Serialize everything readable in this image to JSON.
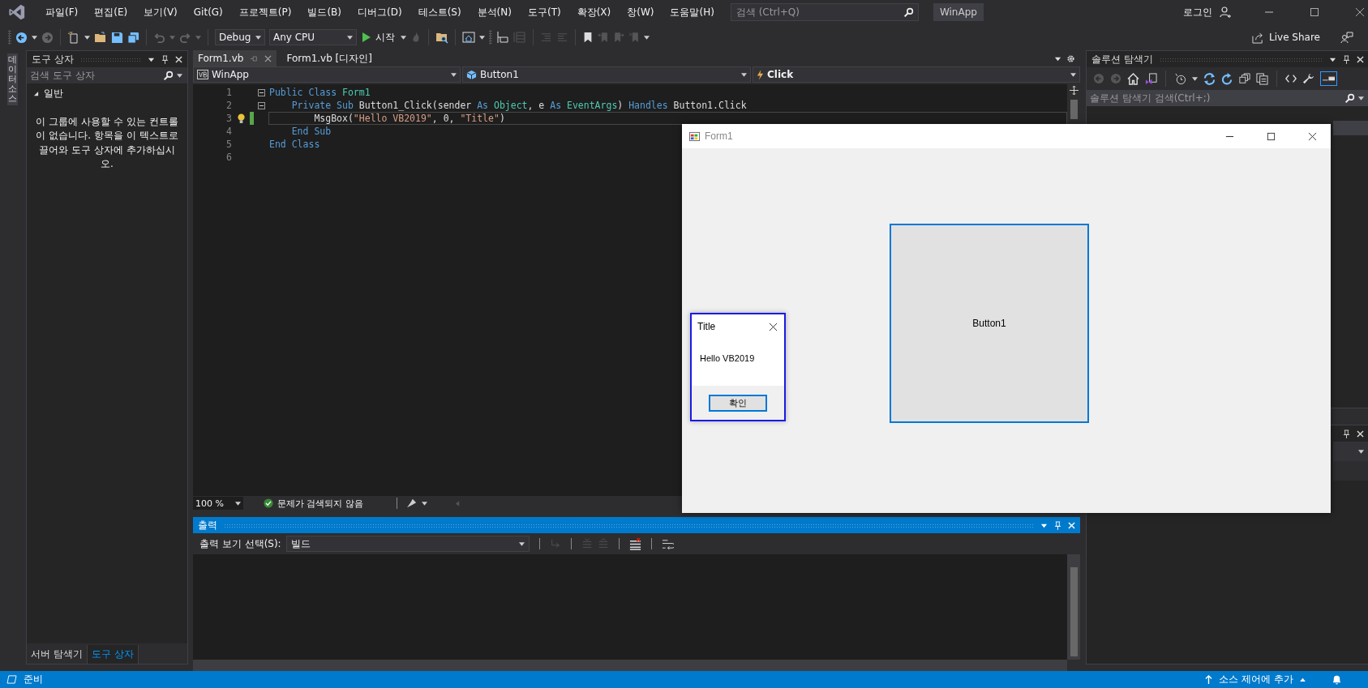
{
  "menu_bar": {
    "items": [
      "파일(F)",
      "편집(E)",
      "보기(V)",
      "Git(G)",
      "프로젝트(P)",
      "빌드(B)",
      "디버그(D)",
      "테스트(S)",
      "분석(N)",
      "도구(T)",
      "확장(X)",
      "창(W)",
      "도움말(H)"
    ],
    "search": {
      "placeholder": "검색 (Ctrl+Q)"
    },
    "solution_name": "WinApp",
    "login": "로그인"
  },
  "toolbar": {
    "configuration": "Debug",
    "platform": "Any CPU",
    "start": "시작",
    "live_share": "Live Share"
  },
  "side_tab": {
    "label": "데이터 소스"
  },
  "toolbox": {
    "title": "도구 상자",
    "search": {
      "placeholder": "검색 도구 상자"
    },
    "group": {
      "label": "일반",
      "expanded": true
    },
    "empty_message": "이 그룹에 사용할 수 있는 컨트롤이 없습니다. 항목을 이 텍스트로 끌어와 도구 상자에 추가하십시오.",
    "tabs": [
      {
        "label": "서버 탐색기",
        "selected": false
      },
      {
        "label": "도구 상자",
        "selected": true
      }
    ]
  },
  "editor": {
    "tabs": [
      {
        "label": "Form1.vb",
        "selected": true
      },
      {
        "label": "Form1.vb [디자인]",
        "selected": false
      }
    ],
    "nav": {
      "project": "WinApp",
      "object": "Button1",
      "member": "Click"
    },
    "lines": [
      {
        "number": "1",
        "fold": true,
        "current": false,
        "modified": false,
        "lightbulb": false,
        "segments": [
          {
            "text": "Public Class",
            "kind": "keyword"
          },
          {
            "text": " Form1",
            "kind": "type"
          }
        ]
      },
      {
        "number": "2",
        "fold": true,
        "current": false,
        "modified": false,
        "lightbulb": false,
        "segments": [
          {
            "text": "    Private Sub",
            "kind": "keyword"
          },
          {
            "text": " Button1_Click(sender ",
            "kind": "plain"
          },
          {
            "text": "As ",
            "kind": "keyword"
          },
          {
            "text": "Object",
            "kind": "type"
          },
          {
            "text": ", e ",
            "kind": "plain"
          },
          {
            "text": "As ",
            "kind": "keyword"
          },
          {
            "text": "EventArgs",
            "kind": "type"
          },
          {
            "text": ") ",
            "kind": "plain"
          },
          {
            "text": "Handles",
            "kind": "keyword"
          },
          {
            "text": " Button1.Click",
            "kind": "plain"
          }
        ]
      },
      {
        "number": "3",
        "fold": false,
        "current": true,
        "modified": true,
        "lightbulb": true,
        "segments": [
          {
            "text": "        MsgBox(",
            "kind": "plain"
          },
          {
            "text": "\"Hello VB2019\"",
            "kind": "string"
          },
          {
            "text": ", 0, ",
            "kind": "plain"
          },
          {
            "text": "\"Title\"",
            "kind": "string"
          },
          {
            "text": ")",
            "kind": "plain"
          }
        ]
      },
      {
        "number": "4",
        "fold": false,
        "current": false,
        "modified": false,
        "lightbulb": false,
        "segments": [
          {
            "text": "    End Sub",
            "kind": "keyword"
          }
        ]
      },
      {
        "number": "5",
        "fold": false,
        "current": false,
        "modified": false,
        "lightbulb": false,
        "segments": [
          {
            "text": "End Class",
            "kind": "keyword"
          }
        ]
      },
      {
        "number": "6",
        "fold": false,
        "current": false,
        "modified": false,
        "lightbulb": false
      }
    ],
    "zoom": "100 %",
    "issues": "문제가 검색되지 않음"
  },
  "output": {
    "title": "출력",
    "source_label": "출력 보기 선택(S):",
    "source": "빌드"
  },
  "solution_explorer": {
    "title": "솔루션 탐색기",
    "search": {
      "placeholder": "솔루션 탐색기 검색(Ctrl+;)"
    }
  },
  "form_window": {
    "title": "Form1",
    "button": "Button1"
  },
  "message_box": {
    "title": "Title",
    "message": "Hello VB2019",
    "ok": "확인"
  },
  "status_bar": {
    "status": "준비",
    "source_control": "소스 제어에 추가"
  }
}
